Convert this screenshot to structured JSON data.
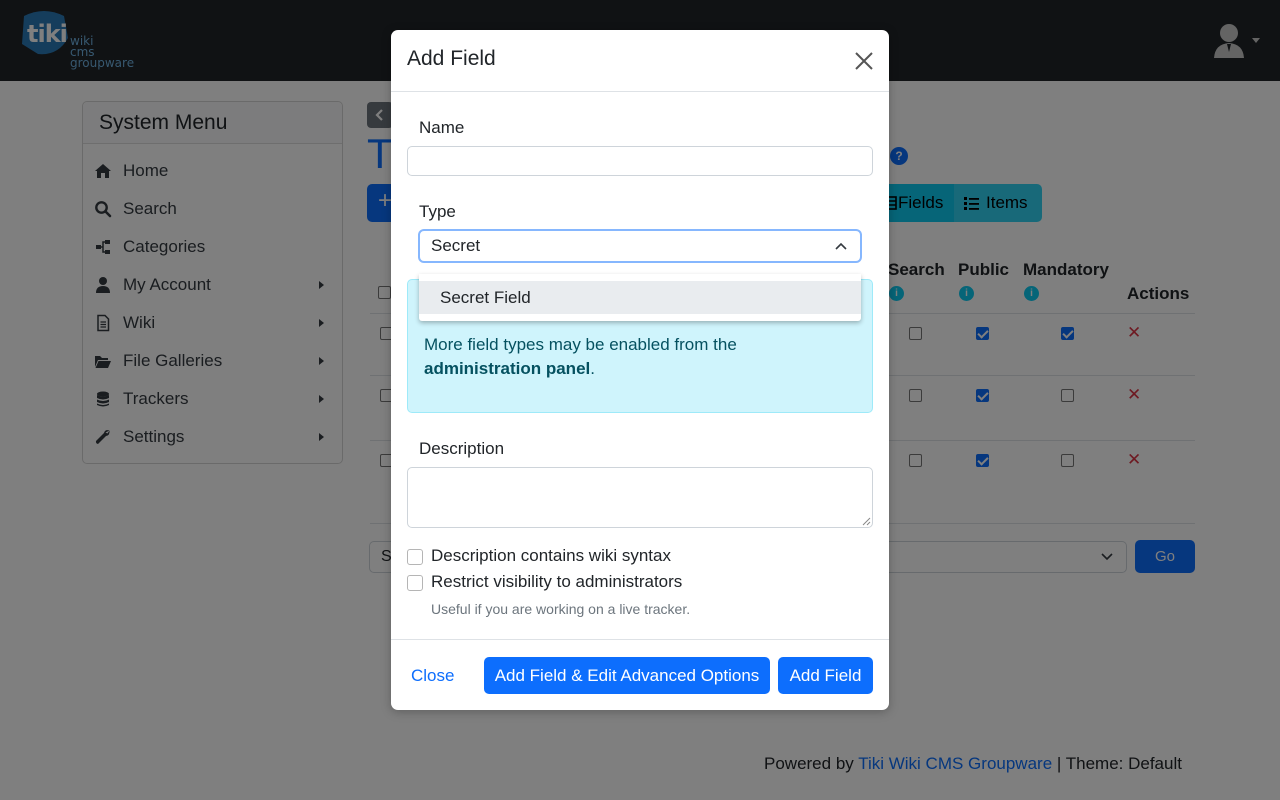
{
  "app": {
    "logo_word": "tiki",
    "logo_sub": [
      "wiki",
      "cms",
      "groupware"
    ]
  },
  "system_menu": {
    "title": "System Menu",
    "items": [
      {
        "label": "Home",
        "icon": "home-icon",
        "has_submenu": false
      },
      {
        "label": "Search",
        "icon": "search-icon",
        "has_submenu": false
      },
      {
        "label": "Categories",
        "icon": "sitemap-icon",
        "has_submenu": false
      },
      {
        "label": "My Account",
        "icon": "user-icon",
        "has_submenu": true
      },
      {
        "label": "Wiki",
        "icon": "file-text-icon",
        "has_submenu": true
      },
      {
        "label": "File Galleries",
        "icon": "folder-open-icon",
        "has_submenu": true
      },
      {
        "label": "Trackers",
        "icon": "database-icon",
        "has_submenu": true
      },
      {
        "label": "Settings",
        "icon": "wrench-icon",
        "has_submenu": true
      }
    ]
  },
  "background_page": {
    "title_fragment": "T",
    "help_icon": "?",
    "add_fragment": "+",
    "nav_buttons": {
      "fields": "Fields",
      "items": "Items"
    },
    "table": {
      "headers": {
        "search": "Search",
        "public": "Public",
        "mandatory": "Mandatory",
        "actions": "Actions"
      },
      "rows": [
        {
          "search": false,
          "public": true,
          "mandatory": true
        },
        {
          "search": false,
          "public": true,
          "mandatory": false
        },
        {
          "search": false,
          "public": true,
          "mandatory": false
        }
      ]
    },
    "bulk_select_fragment": "S",
    "go_button": "Go"
  },
  "footer": {
    "powered_by": "Powered by",
    "link": "Tiki Wiki CMS Groupware",
    "separator": "|",
    "theme": "Theme: Default"
  },
  "modal": {
    "title": "Add Field",
    "name_label": "Name",
    "name_value": "",
    "type_label": "Type",
    "type_value": "Secret",
    "dropdown_options": [
      "Secret Field"
    ],
    "alert_text": "More field types may be enabled from the",
    "alert_link": "administration panel",
    "alert_end": ".",
    "description_label": "Description",
    "description_value": "",
    "wiki_syntax_label": "Description contains wiki syntax",
    "restrict_label": "Restrict visibility to administrators",
    "restrict_hint": "Useful if you are working on a live tracker.",
    "close_button": "Close",
    "advanced_button": "Add Field & Edit Advanced Options",
    "add_button": "Add Field"
  },
  "colors": {
    "primary": "#0d6efd",
    "topbar": "#212529",
    "info_alert_bg": "#cff4fc",
    "info_alert_text": "#055160",
    "danger": "#dc3545"
  }
}
